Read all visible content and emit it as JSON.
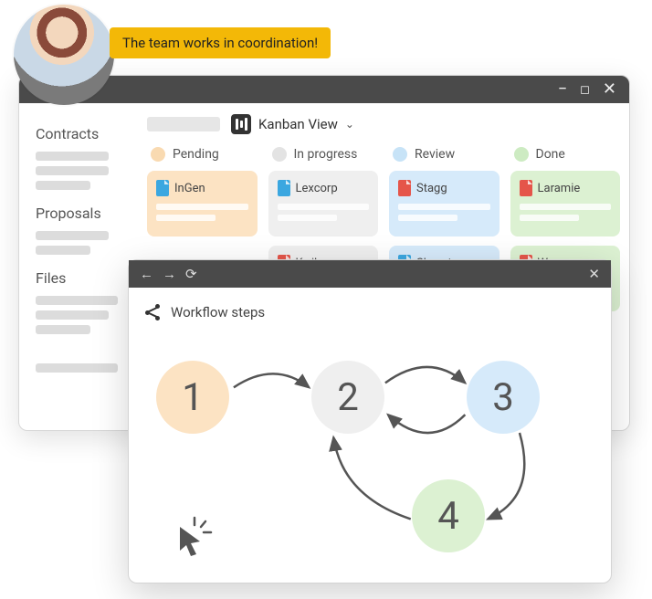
{
  "bubble_text": "The team works in coordination!",
  "main_window": {
    "view_label": "Kanban View",
    "sidebar": {
      "sections": [
        "Contracts",
        "Proposals",
        "Files"
      ]
    },
    "columns": [
      {
        "label": "Pending",
        "color": "orange",
        "cards": [
          {
            "name": "InGen",
            "icon": "blue"
          }
        ]
      },
      {
        "label": "In progress",
        "color": "grey",
        "cards": [
          {
            "name": "Lexcorp",
            "icon": "blue"
          },
          {
            "name": "Kwik",
            "icon": "red"
          }
        ]
      },
      {
        "label": "Review",
        "color": "blue",
        "cards": [
          {
            "name": "Stagg",
            "icon": "red"
          },
          {
            "name": "Skynet",
            "icon": "blue"
          }
        ]
      },
      {
        "label": "Done",
        "color": "green",
        "cards": [
          {
            "name": "Laramie",
            "icon": "red"
          },
          {
            "name": "Wayne",
            "icon": "red"
          }
        ]
      }
    ]
  },
  "overlay": {
    "title": "Workflow steps",
    "steps": [
      "1",
      "2",
      "3",
      "4"
    ]
  }
}
